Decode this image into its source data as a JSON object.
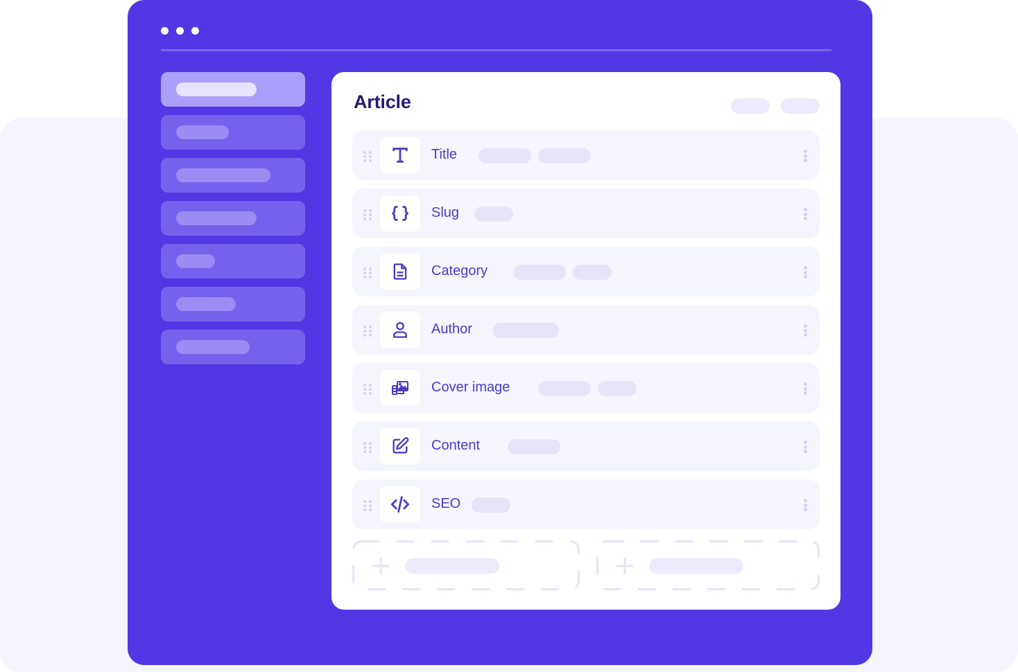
{
  "colors": {
    "brand": "#5138e4",
    "backdrop": "#f5f4ff",
    "sidebar_item": "#7562ec",
    "sidebar_item_active": "#aa9ffa",
    "panel_title": "#241a7a",
    "field_label": "#4a3bc2",
    "field_bg": "#f5f5fe",
    "placeholder_pill": "#e6e5f8"
  },
  "window": {
    "controls": [
      "dot",
      "dot",
      "dot"
    ]
  },
  "sidebar": {
    "items": [
      {
        "active": true
      },
      {
        "active": false
      },
      {
        "active": false
      },
      {
        "active": false
      },
      {
        "active": false
      },
      {
        "active": false
      },
      {
        "active": false
      }
    ]
  },
  "panel": {
    "title": "Article",
    "fields": [
      {
        "label": "Title",
        "icon": "text-type-icon",
        "pills": 2
      },
      {
        "label": "Slug",
        "icon": "curly-braces-icon",
        "pills": 1
      },
      {
        "label": "Category",
        "icon": "document-icon",
        "pills": 2
      },
      {
        "label": "Author",
        "icon": "user-icon",
        "pills": 1
      },
      {
        "label": "Cover image",
        "icon": "media-image-icon",
        "pills": 2
      },
      {
        "label": "Content",
        "icon": "edit-pencil-icon",
        "pills": 1
      },
      {
        "label": "SEO",
        "icon": "code-icon",
        "pills": 1
      }
    ],
    "add_buttons": [
      {
        "icon": "plus-icon"
      },
      {
        "icon": "plus-icon"
      }
    ]
  }
}
